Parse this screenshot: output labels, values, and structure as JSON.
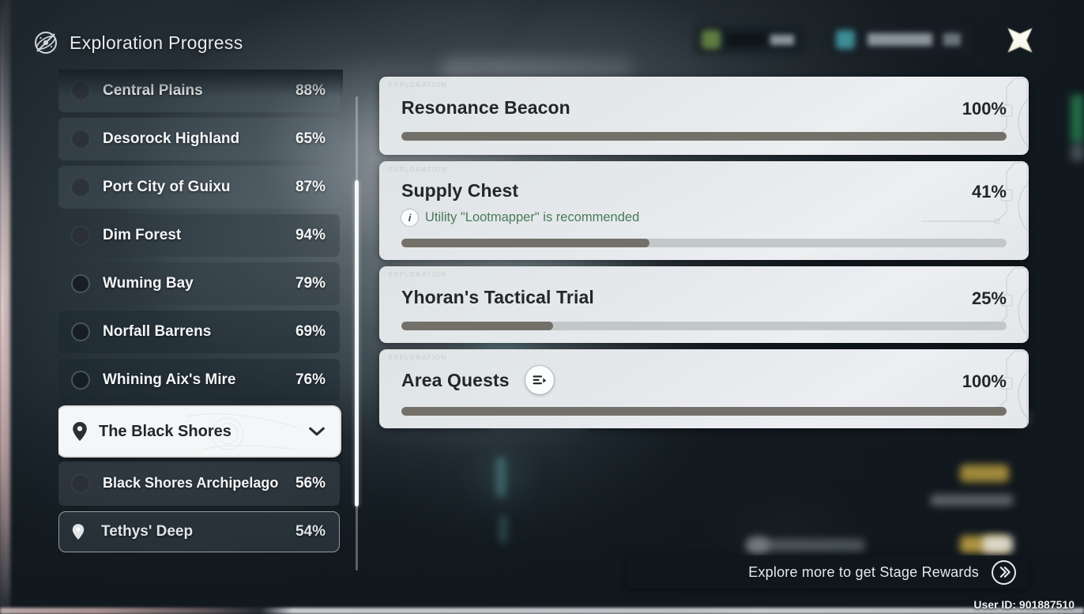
{
  "header": {
    "title": "Exploration Progress",
    "icon": "exploration-compass-icon"
  },
  "hud": {
    "star_icon": "four-point-star-icon"
  },
  "sidebar": {
    "regions": [
      {
        "name": "Central Plains",
        "percent": "88%",
        "style": "dim",
        "dot": "filled",
        "type": "region"
      },
      {
        "name": "Desorock Highland",
        "percent": "65%",
        "style": "dim",
        "dot": "filled",
        "type": "region"
      },
      {
        "name": "Port City of Guixu",
        "percent": "87%",
        "style": "dim",
        "dot": "filled",
        "type": "region"
      },
      {
        "name": "Dim Forest",
        "percent": "94%",
        "style": "dark",
        "dot": "filled",
        "type": "region"
      },
      {
        "name": "Wuming Bay",
        "percent": "79%",
        "style": "dark",
        "dot": "outline",
        "type": "region"
      },
      {
        "name": "Norfall Barrens",
        "percent": "69%",
        "style": "darker",
        "dot": "outline",
        "type": "region"
      },
      {
        "name": "Whining Aix's Mire",
        "percent": "76%",
        "style": "darker",
        "dot": "outline",
        "type": "region"
      }
    ],
    "selected_group": {
      "name": "The Black Shores",
      "pin_icon": "map-pin-icon",
      "chevron_icon": "chevron-down-icon"
    },
    "sub_regions": [
      {
        "name": "Black Shores Archipelago",
        "percent": "56%",
        "dot": "filled",
        "highlighted": false
      },
      {
        "name": "Tethys' Deep",
        "percent": "54%",
        "pin_icon": "map-pin-icon",
        "highlighted": true
      }
    ]
  },
  "main": {
    "cards": [
      {
        "watermark": "EXPLORATION",
        "title": "Resonance Beacon",
        "percent": "100%",
        "progress": 100,
        "hint": null,
        "button": null
      },
      {
        "watermark": "EXPLORATION",
        "title": "Supply Chest",
        "percent": "41%",
        "progress": 41,
        "hint": {
          "icon": "info-icon",
          "badge": "i",
          "text": "Utility \"Lootmapper\" is recommended"
        },
        "button": null
      },
      {
        "watermark": "EXPLORATION",
        "title": "Yhoran's Tactical Trial",
        "percent": "25%",
        "progress": 25,
        "hint": null,
        "button": null
      },
      {
        "watermark": "EXPLORATION",
        "title": "Area Quests",
        "percent": "100%",
        "progress": 100,
        "hint": null,
        "button": {
          "icon": "quest-list-icon",
          "label": ""
        }
      }
    ]
  },
  "footer": {
    "cta_text": "Explore more to get Stage Rewards",
    "cta_icon": "double-chevron-right-icon",
    "user_id": "User ID: 901887510"
  },
  "colors": {
    "accent_green": "#4a7a5a",
    "progress_fill": "#73706a",
    "progress_track": "#c2c7c9",
    "card_bg": "#e6e9ec",
    "panel_dark": "#162026",
    "text_light": "#f2f5f7",
    "text_dark": "#23262a"
  }
}
